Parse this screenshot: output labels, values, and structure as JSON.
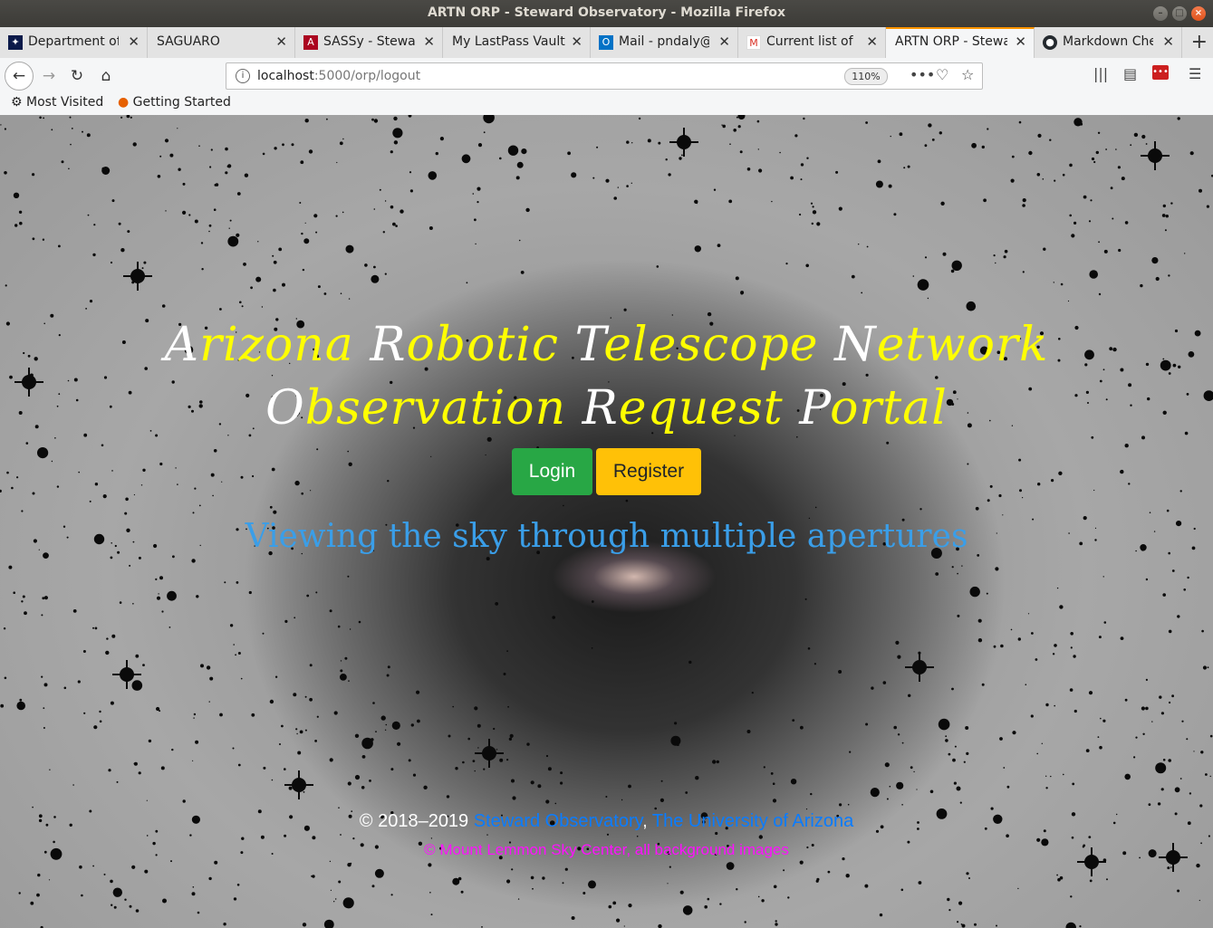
{
  "window": {
    "title": "ARTN ORP - Steward Observatory - Mozilla Firefox"
  },
  "tabs": [
    {
      "label": "Department of",
      "icon": "space-favicon"
    },
    {
      "label": "SAGUARO",
      "icon": ""
    },
    {
      "label": "SASSy - Steward",
      "icon": "arizona-favicon"
    },
    {
      "label": "My LastPass Vault",
      "icon": ""
    },
    {
      "label": "Mail - pndaly@",
      "icon": "outlook-favicon"
    },
    {
      "label": "Current list of",
      "icon": "gmail-favicon"
    },
    {
      "label": "ARTN ORP - Stewar",
      "icon": "",
      "active": true
    },
    {
      "label": "Markdown Che",
      "icon": "github-favicon"
    }
  ],
  "nav": {
    "url_host": "localhost",
    "url_rest": ":5000/orp/logout",
    "zoom": "110%"
  },
  "bookmarks": [
    {
      "label": "Most Visited",
      "icon": "gear-icon"
    },
    {
      "label": "Getting Started",
      "icon": "firefox-icon"
    }
  ],
  "page": {
    "title_line1": [
      {
        "cap": "A",
        "rest": "rizona"
      },
      {
        "cap": "R",
        "rest": "obotic"
      },
      {
        "cap": "T",
        "rest": "elescope"
      },
      {
        "cap": "N",
        "rest": "etwork"
      }
    ],
    "title_line2": [
      {
        "cap": "O",
        "rest": "bservation"
      },
      {
        "cap": "R",
        "rest": "equest"
      },
      {
        "cap": "P",
        "rest": "ortal"
      }
    ],
    "login_label": "Login",
    "register_label": "Register",
    "tagline": "Viewing the sky through multiple apertures",
    "footer": {
      "copyright": "© 2018–2019",
      "org1": "Steward Observatory",
      "separator": ",",
      "org2": "The University of Arizona",
      "credit": "© Mount Lemmon Sky Center, all background images"
    }
  },
  "colors": {
    "title_yellow": "#ffff00",
    "login_green": "#28a745",
    "register_yellow": "#ffc107",
    "tagline_blue": "#3a9ee8",
    "link_blue": "#0a7cff",
    "credit_magenta": "#ff10ff"
  }
}
